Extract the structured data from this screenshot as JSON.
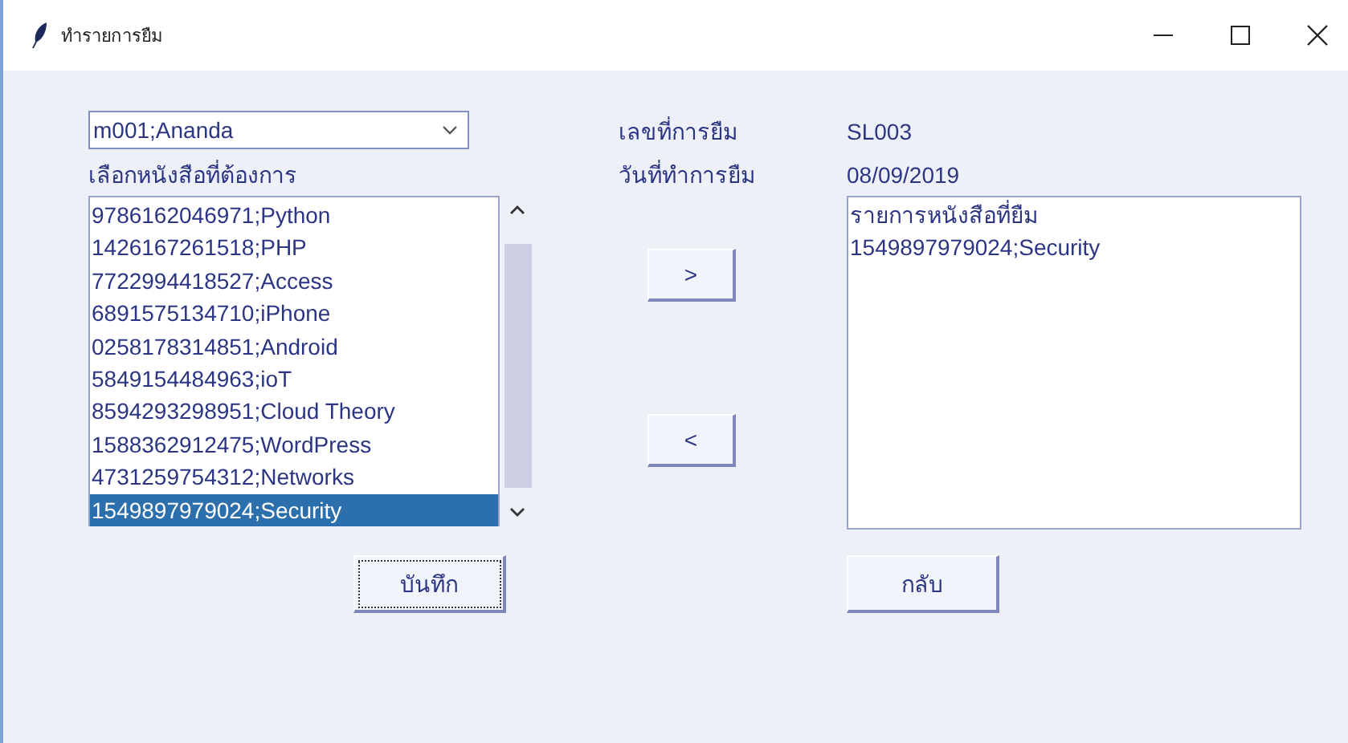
{
  "window": {
    "title": "ทำรายการยืม"
  },
  "member_combo": {
    "value": "m001;Ananda"
  },
  "book_list_label": "เลือกหนังสือที่ต้องการ",
  "book_list": [
    {
      "text": "9786162046971;Python",
      "selected": false
    },
    {
      "text": "1426167261518;PHP",
      "selected": false
    },
    {
      "text": "7722994418527;Access",
      "selected": false
    },
    {
      "text": "6891575134710;iPhone",
      "selected": false
    },
    {
      "text": "0258178314851;Android",
      "selected": false
    },
    {
      "text": "5849154484963;ioT",
      "selected": false
    },
    {
      "text": "8594293298951;Cloud Theory",
      "selected": false
    },
    {
      "text": "1588362912475;WordPress",
      "selected": false
    },
    {
      "text": "4731259754312;Networks",
      "selected": false
    },
    {
      "text": "1549897979024;Security",
      "selected": true
    }
  ],
  "loan_number": {
    "label": "เลขที่การยืม",
    "value": "SL003"
  },
  "loan_date": {
    "label": "วันที่ทำการยืม",
    "value": "08/09/2019"
  },
  "move_buttons": [
    ">",
    "<"
  ],
  "borrowed_list": {
    "lines": [
      "รายการหนังสือที่ยืม",
      "1549897979024;Security"
    ]
  },
  "save_button": {
    "label": "บันทึก",
    "focused": true
  },
  "back_button": {
    "label": "กลับ",
    "focused": false
  }
}
